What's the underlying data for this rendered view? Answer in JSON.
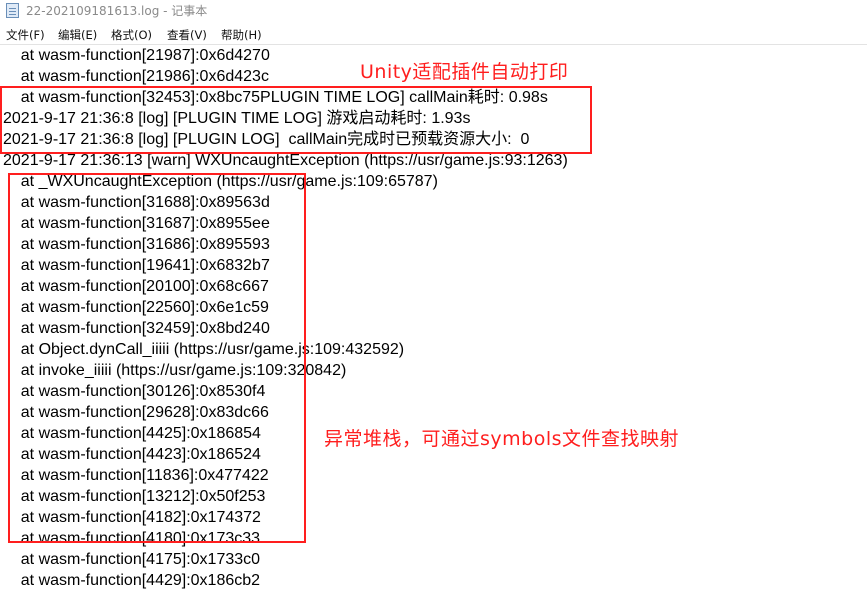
{
  "window": {
    "title": "22-202109181613.log - 记事本"
  },
  "menu": [
    "文件(F)",
    "编辑(E)",
    "格式(O)",
    "查看(V)",
    "帮助(H)"
  ],
  "lines": [
    "    at wasm-function[21987]:0x6d4270",
    "    at wasm-function[21986]:0x6d423c",
    "    at wasm-function[32453]:0x8bc75PLUGIN TIME LOG] callMain耗时: 0.98s",
    "2021-9-17 21:36:8 [log] [PLUGIN TIME LOG] 游戏启动耗时: 1.93s",
    "2021-9-17 21:36:8 [log] [PLUGIN LOG]  callMain完成时已预载资源大小:  0",
    "2021-9-17 21:36:13 [warn] WXUncaughtException (https://usr/game.js:93:1263)",
    "    at _WXUncaughtException (https://usr/game.js:109:65787)",
    "    at wasm-function[31688]:0x89563d",
    "    at wasm-function[31687]:0x8955ee",
    "    at wasm-function[31686]:0x895593",
    "    at wasm-function[19641]:0x6832b7",
    "    at wasm-function[20100]:0x68c667",
    "    at wasm-function[22560]:0x6e1c59",
    "    at wasm-function[32459]:0x8bd240",
    "    at Object.dynCall_iiiii (https://usr/game.js:109:432592)",
    "    at invoke_iiiii (https://usr/game.js:109:320842)",
    "    at wasm-function[30126]:0x8530f4",
    "    at wasm-function[29628]:0x83dc66",
    "    at wasm-function[4425]:0x186854",
    "    at wasm-function[4423]:0x186524",
    "    at wasm-function[11836]:0x477422",
    "    at wasm-function[13212]:0x50f253",
    "    at wasm-function[4182]:0x174372",
    "    at wasm-function[4180]:0x173c33",
    "    at wasm-function[4175]:0x1733c0",
    "    at wasm-function[4429]:0x186cb2"
  ],
  "annotations": {
    "plugin_log_note": "Unity适配插件自动打印",
    "stack_note": "异常堆栈，可通过symbols文件查找映射",
    "color": "#ff1e1e"
  }
}
